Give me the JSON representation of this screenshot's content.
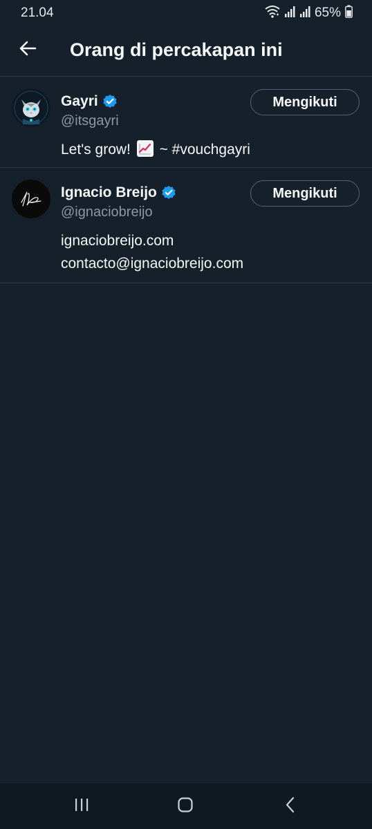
{
  "status_bar": {
    "time": "21.04",
    "battery": "65%"
  },
  "header": {
    "back_icon": "arrow-left-icon",
    "title": "Orang di percakapan ini"
  },
  "users": [
    {
      "name": "Gayri",
      "handle": "@itsgayri",
      "bio_before": "Let's grow!",
      "bio_emoji": "chart-increasing-icon",
      "bio_after": "~ #vouchgayri",
      "follow_label": "Mengikuti",
      "verified": true
    },
    {
      "name": "Ignacio Breijo",
      "handle": "@ignaciobreijo",
      "bio_line1": "ignaciobreijo.com",
      "bio_line2": "contacto@ignaciobreijo.com",
      "follow_label": "Mengikuti",
      "verified": true
    }
  ],
  "colors": {
    "background": "#15202b",
    "verified": "#1d9bf0",
    "handle": "#8b98a5",
    "divider": "#2f3a45"
  }
}
